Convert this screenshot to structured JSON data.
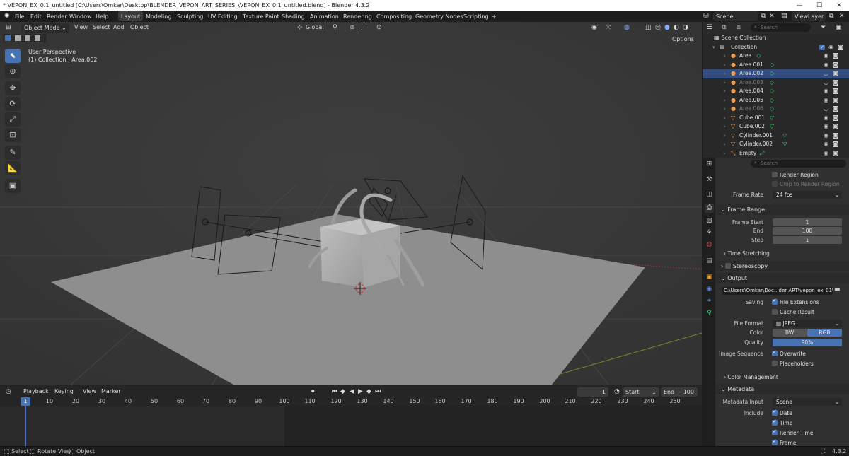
{
  "titlebar": {
    "text": "* VEPON_EX_0.1_untitled [C:\\Users\\Omkar\\Desktop\\BLENDER_VEPON_ART_SERIES_\\VEPON_EX_0.1_untitled.blend] - Blender 4.3.2"
  },
  "menus": [
    "File",
    "Edit",
    "Render",
    "Window",
    "Help"
  ],
  "workspaces": [
    "Layout",
    "Modeling",
    "Sculpting",
    "UV Editing",
    "Texture Paint",
    "Shading",
    "Animation",
    "Rendering",
    "Compositing",
    "Geometry Nodes",
    "Scripting"
  ],
  "active_workspace": "Layout",
  "scene": {
    "name": "Scene",
    "view_layer": "ViewLayer"
  },
  "viewport": {
    "mode": "Object Mode",
    "menus": [
      "View",
      "Select",
      "Add",
      "Object"
    ],
    "orientation": "Global",
    "options_label": "Options",
    "overlay_title": "User Perspective",
    "overlay_sub": "(1) Collection | Area.002"
  },
  "timeline": {
    "menus": [
      "Playback",
      "Keying",
      "View",
      "Marker"
    ],
    "current_frame": "1",
    "start_label": "Start",
    "start": "1",
    "end_label": "End",
    "end": "100",
    "ruler": [
      "1",
      "10",
      "20",
      "30",
      "40",
      "50",
      "60",
      "70",
      "80",
      "90",
      "100",
      "110",
      "120",
      "130",
      "140",
      "150",
      "160",
      "170",
      "180",
      "190",
      "200",
      "210",
      "220",
      "230",
      "240",
      "250"
    ]
  },
  "statusbar": {
    "select": "Select",
    "rotate": "Rotate View",
    "object": "Object",
    "version": "4.3.2"
  },
  "outliner": {
    "search_placeholder": "Search",
    "scene_collection": "Scene Collection",
    "collection": "Collection",
    "items": [
      {
        "name": "Area",
        "type": "light",
        "state": "normal"
      },
      {
        "name": "Area.001",
        "type": "light",
        "state": "normal"
      },
      {
        "name": "Area.002",
        "type": "light",
        "state": "selected"
      },
      {
        "name": "Area.003",
        "type": "light",
        "state": "hidden"
      },
      {
        "name": "Area.004",
        "type": "light",
        "state": "normal"
      },
      {
        "name": "Area.005",
        "type": "light",
        "state": "normal"
      },
      {
        "name": "Area.006",
        "type": "light",
        "state": "hidden"
      },
      {
        "name": "Cube.001",
        "type": "mesh",
        "state": "normal"
      },
      {
        "name": "Cube.002",
        "type": "mesh",
        "state": "normal"
      },
      {
        "name": "Cylinder.001",
        "type": "mesh",
        "state": "normal"
      },
      {
        "name": "Cylinder.002",
        "type": "mesh",
        "state": "normal"
      },
      {
        "name": "Empty",
        "type": "empty",
        "state": "normal"
      }
    ]
  },
  "properties": {
    "search_placeholder": "Search",
    "render_region": "Render Region",
    "crop_region": "Crop to Render Region",
    "frame_rate_label": "Frame Rate",
    "frame_rate": "24 fps",
    "frame_range_title": "Frame Range",
    "frame_start_label": "Frame Start",
    "frame_start": "1",
    "end_label": "End",
    "end": "100",
    "step_label": "Step",
    "step": "1",
    "time_stretching": "Time Stretching",
    "stereoscopy": "Stereoscopy",
    "output_title": "Output",
    "output_path": "C:\\Users\\Omkar\\Doc...der ART\\vepon_ex_01\\",
    "saving_label": "Saving",
    "file_extensions": "File Extensions",
    "cache_result": "Cache Result",
    "file_format_label": "File Format",
    "file_format": "JPEG",
    "color_label": "Color",
    "color_bw": "BW",
    "color_rgb": "RGB",
    "quality_label": "Quality",
    "quality": "90%",
    "image_sequence_label": "Image Sequence",
    "overwrite": "Overwrite",
    "placeholders": "Placeholders",
    "color_management": "Color Management",
    "metadata_title": "Metadata",
    "metadata_input_label": "Metadata Input",
    "metadata_input": "Scene",
    "include_label": "Include",
    "date": "Date",
    "time": "Time",
    "render_time": "Render Time",
    "frame": "Frame"
  },
  "colors": {
    "accent": "#4772b3",
    "selected_row": "#334d80",
    "light_icon": "#e8a05a",
    "mesh_icon": "#e8a05a",
    "data_icon": "#3ad07a"
  }
}
